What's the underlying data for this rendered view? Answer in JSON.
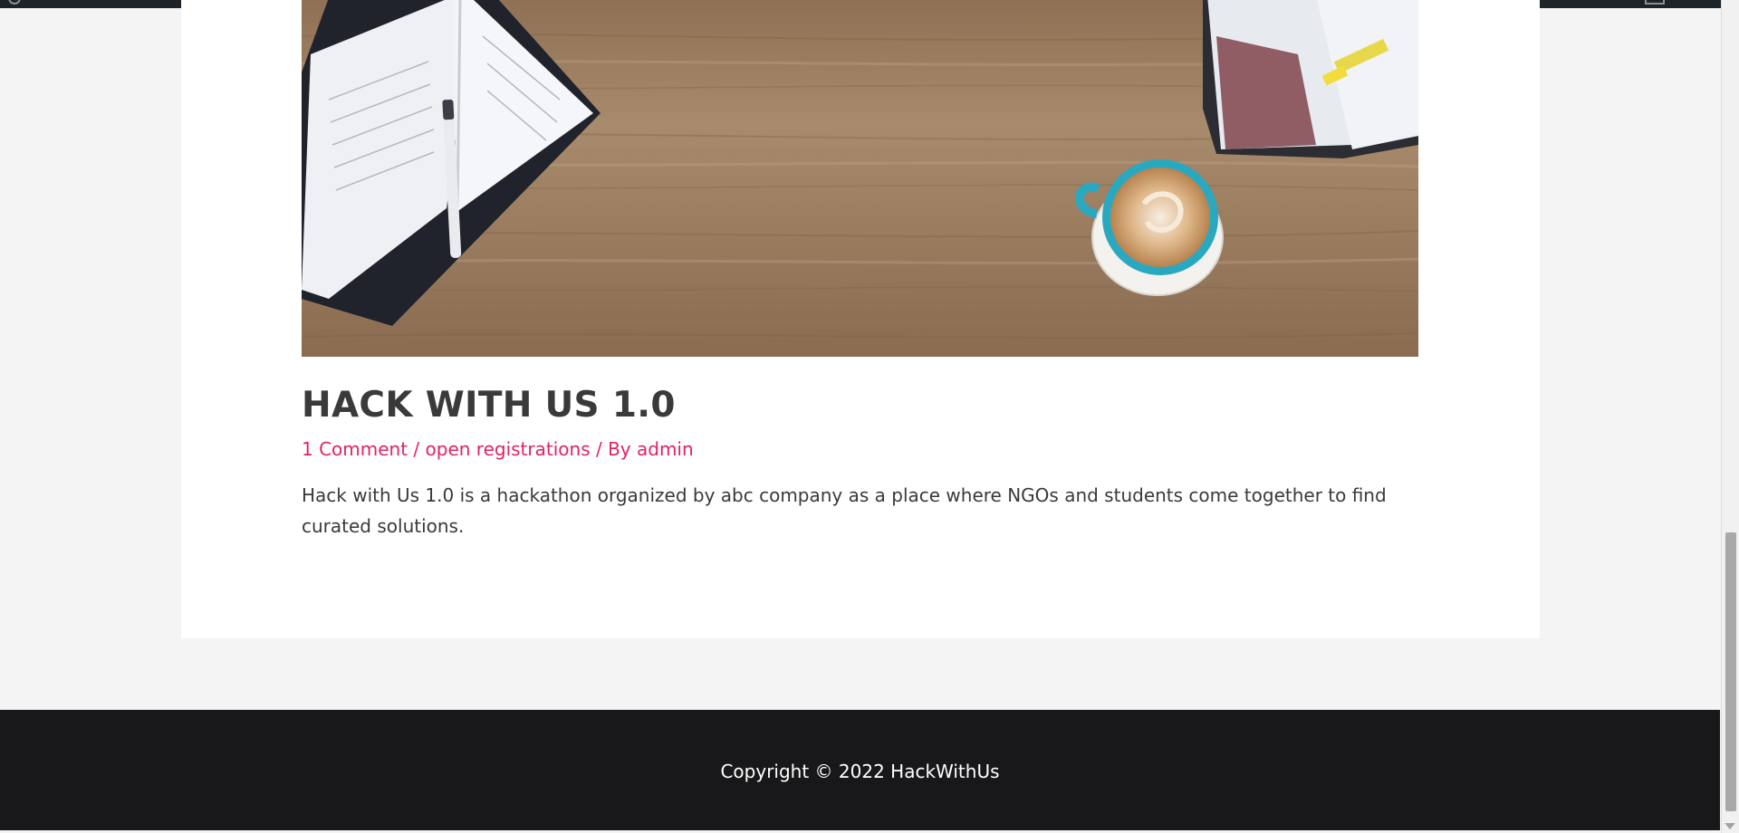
{
  "post": {
    "title": "HACK WITH US 1.0",
    "meta": {
      "comments": "1 Comment",
      "separator_1": " / ",
      "category": "open registrations",
      "separator_2": " / By ",
      "author": "admin"
    },
    "excerpt": "Hack with Us 1.0 is a hackathon organized by abc company as a place where NGOs and students come together to find curated solutions."
  },
  "footer": {
    "copyright": "Copyright © 2022 HackWithUs"
  },
  "icons": {
    "admin_bar_logo": "wordpress-logo-icon",
    "scroll_down": "chevron-down-icon"
  },
  "colors": {
    "accent": "#e0245e",
    "text": "#3a3a3a",
    "footer_bg": "#18181a",
    "page_bg": "#f4f4f4"
  }
}
